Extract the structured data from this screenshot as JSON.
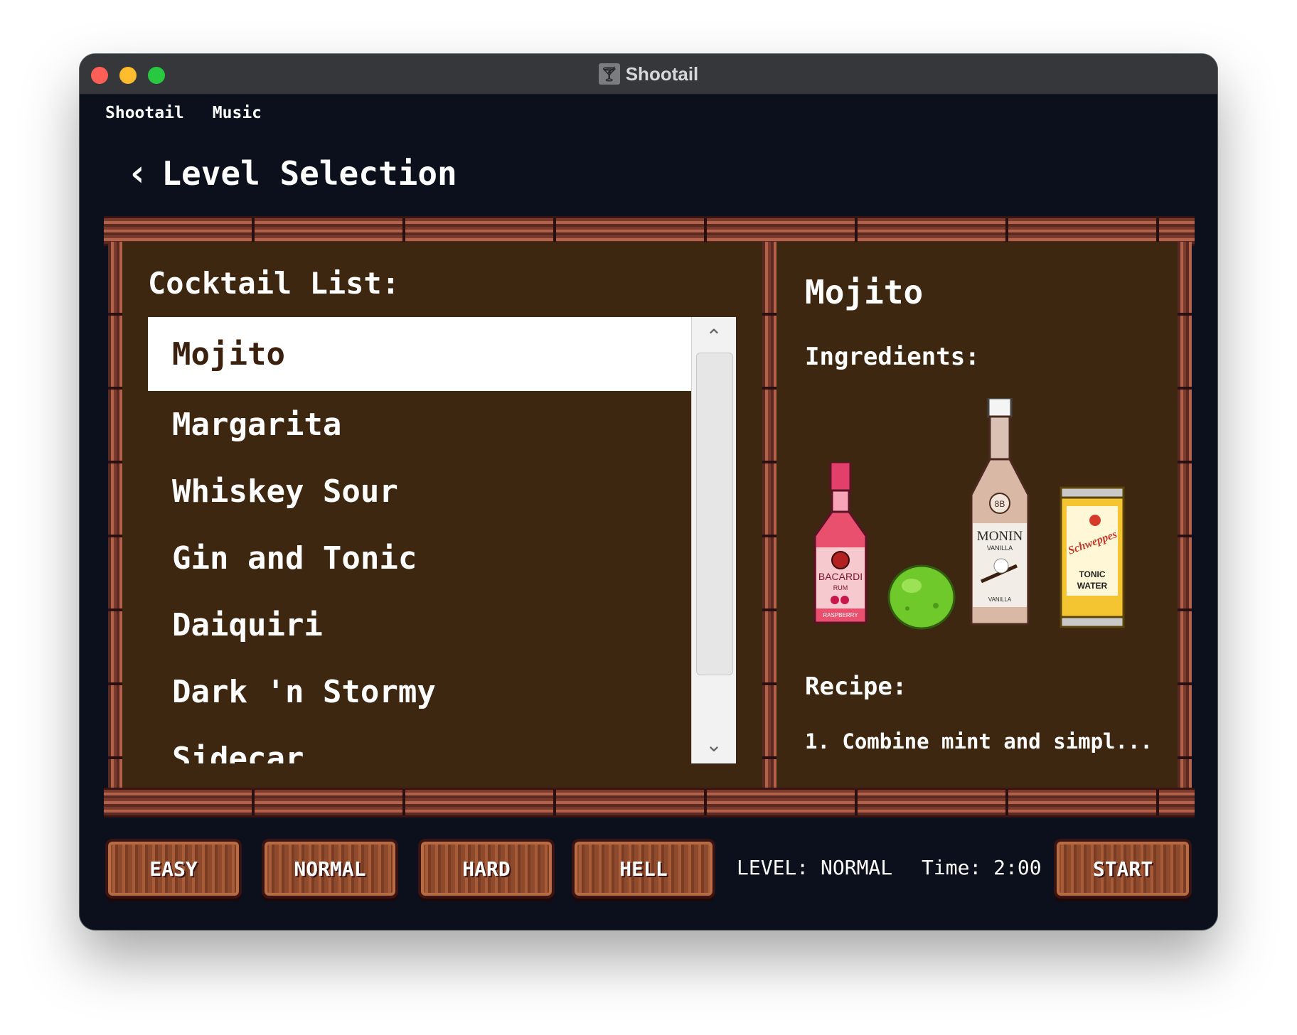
{
  "window": {
    "title": "Shootail",
    "title_icon": "cocktail-glass-icon"
  },
  "menubar": {
    "items": [
      {
        "label": "Shootail"
      },
      {
        "label": "Music"
      }
    ]
  },
  "header": {
    "title": "Level Selection",
    "back_icon": "chevron-left-icon"
  },
  "cocktail_list": {
    "title": "Cocktail List:",
    "items": [
      {
        "label": "Mojito",
        "selected": true
      },
      {
        "label": "Margarita"
      },
      {
        "label": "Whiskey Sour"
      },
      {
        "label": "Gin and Tonic"
      },
      {
        "label": "Daiquiri"
      },
      {
        "label": "Dark 'n Stormy"
      },
      {
        "label": "Sidecar"
      }
    ]
  },
  "detail": {
    "title": "Mojito",
    "ingredients_label": "Ingredients:",
    "ingredients": [
      {
        "name": "bacardi-raspberry-rum",
        "label_top": "BACARDI",
        "label_mid": "RUM",
        "label_bottom": "RASPBERRY"
      },
      {
        "name": "lime"
      },
      {
        "name": "monin-vanilla-syrup",
        "label_badge": "8B",
        "label_top": "MONIN",
        "label_mid": "VANILLA",
        "label_bottom": "VANILLA"
      },
      {
        "name": "schweppes-tonic-water",
        "label_top": "Schweppes",
        "label_mid": "TONIC",
        "label_bottom": "WATER"
      }
    ],
    "recipe_label": "Recipe:",
    "recipe_text": "1. Combine mint and simpl..."
  },
  "footer": {
    "buttons": {
      "easy": "EASY",
      "normal": "NORMAL",
      "hard": "HARD",
      "hell": "HELL",
      "start": "START"
    },
    "level_status": "LEVEL: NORMAL",
    "time_status": "Time: 2:00"
  },
  "colors": {
    "window_bg": "#0c0f1c",
    "panel_bg": "#3e2710",
    "wood": "#8d4a2c",
    "selected_row": "#ffffff"
  }
}
